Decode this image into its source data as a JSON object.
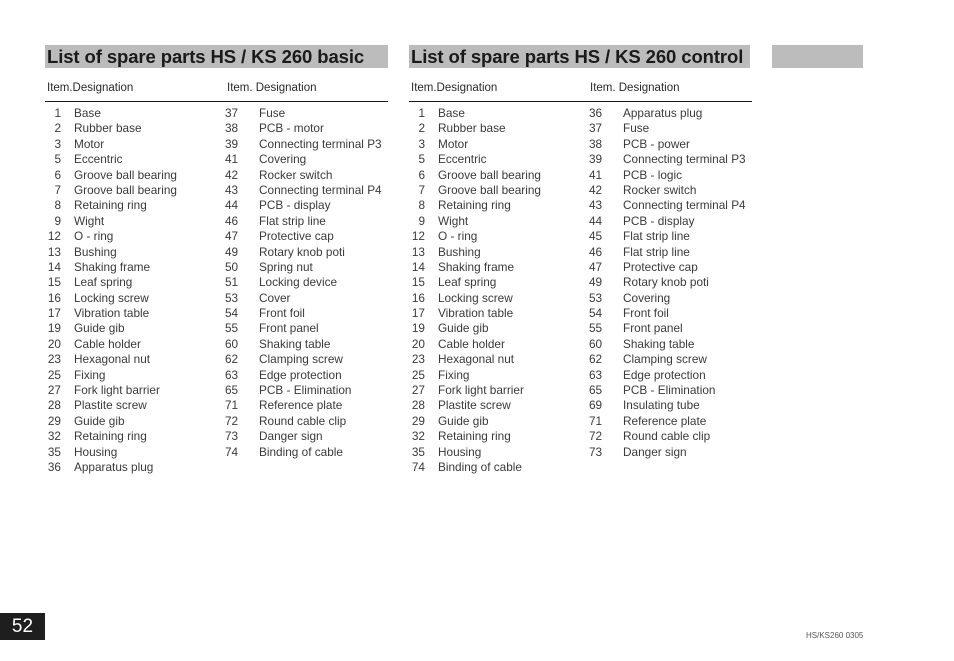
{
  "sections": {
    "basic": {
      "title": "List of spare parts HS / KS 260 basic",
      "header_left": "Item.Designation",
      "header_right": "Item.  Designation",
      "left": [
        {
          "item": "1",
          "name": "Base"
        },
        {
          "item": "2",
          "name": "Rubber base"
        },
        {
          "item": "3",
          "name": "Motor"
        },
        {
          "item": "5",
          "name": "Eccentric"
        },
        {
          "item": "6",
          "name": "Groove ball bearing"
        },
        {
          "item": "7",
          "name": "Groove ball bearing"
        },
        {
          "item": "8",
          "name": "Retaining ring"
        },
        {
          "item": "9",
          "name": "Wight"
        },
        {
          "item": "12",
          "name": "O - ring"
        },
        {
          "item": "13",
          "name": "Bushing"
        },
        {
          "item": "14",
          "name": "Shaking frame"
        },
        {
          "item": "15",
          "name": "Leaf spring"
        },
        {
          "item": "16",
          "name": "Locking screw"
        },
        {
          "item": "17",
          "name": "Vibration table"
        },
        {
          "item": "19",
          "name": "Guide gib"
        },
        {
          "item": "20",
          "name": "Cable holder"
        },
        {
          "item": "23",
          "name": "Hexagonal nut"
        },
        {
          "item": "25",
          "name": "Fixing"
        },
        {
          "item": "27",
          "name": "Fork light barrier"
        },
        {
          "item": "28",
          "name": "Plastite screw"
        },
        {
          "item": "29",
          "name": "Guide gib"
        },
        {
          "item": "32",
          "name": "Retaining ring"
        },
        {
          "item": "35",
          "name": "Housing"
        },
        {
          "item": "36",
          "name": "Apparatus plug"
        }
      ],
      "right": [
        {
          "item": "37",
          "name": "Fuse"
        },
        {
          "item": "38",
          "name": "PCB - motor"
        },
        {
          "item": "39",
          "name": "Connecting terminal P3"
        },
        {
          "item": "41",
          "name": "Covering"
        },
        {
          "item": "42",
          "name": "Rocker switch"
        },
        {
          "item": "43",
          "name": "Connecting terminal P4"
        },
        {
          "item": "44",
          "name": "PCB - display"
        },
        {
          "item": "46",
          "name": "Flat strip line"
        },
        {
          "item": "47",
          "name": "Protective cap"
        },
        {
          "item": "49",
          "name": "Rotary knob poti"
        },
        {
          "item": "50",
          "name": "Spring nut"
        },
        {
          "item": "51",
          "name": "Locking device"
        },
        {
          "item": "53",
          "name": "Cover"
        },
        {
          "item": "54",
          "name": "Front foil"
        },
        {
          "item": "55",
          "name": "Front panel"
        },
        {
          "item": "60",
          "name": "Shaking table"
        },
        {
          "item": "62",
          "name": "Clamping screw"
        },
        {
          "item": "63",
          "name": "Edge protection"
        },
        {
          "item": "65",
          "name": "PCB - Elimination"
        },
        {
          "item": "71",
          "name": "Reference plate"
        },
        {
          "item": "72",
          "name": "Round cable clip"
        },
        {
          "item": "73",
          "name": "Danger sign"
        },
        {
          "item": "74",
          "name": "Binding of cable"
        }
      ]
    },
    "control": {
      "title": "List of spare parts HS / KS 260 control",
      "header_left": "Item.Designation",
      "header_right": "Item.  Designation",
      "left": [
        {
          "item": "1",
          "name": "Base"
        },
        {
          "item": "2",
          "name": "Rubber base"
        },
        {
          "item": "3",
          "name": "Motor"
        },
        {
          "item": "5",
          "name": "Eccentric"
        },
        {
          "item": "6",
          "name": "Groove ball bearing"
        },
        {
          "item": "7",
          "name": "Groove ball bearing"
        },
        {
          "item": "8",
          "name": "Retaining ring"
        },
        {
          "item": "9",
          "name": "Wight"
        },
        {
          "item": "12",
          "name": "O - ring"
        },
        {
          "item": "13",
          "name": "Bushing"
        },
        {
          "item": "14",
          "name": "Shaking frame"
        },
        {
          "item": "15",
          "name": "Leaf spring"
        },
        {
          "item": "16",
          "name": "Locking screw"
        },
        {
          "item": "17",
          "name": "Vibration table"
        },
        {
          "item": "19",
          "name": "Guide gib"
        },
        {
          "item": "20",
          "name": "Cable holder"
        },
        {
          "item": "23",
          "name": "Hexagonal nut"
        },
        {
          "item": "25",
          "name": "Fixing"
        },
        {
          "item": "27",
          "name": "Fork light barrier"
        },
        {
          "item": "28",
          "name": "Plastite screw"
        },
        {
          "item": "29",
          "name": "Guide gib"
        },
        {
          "item": "32",
          "name": "Retaining ring"
        },
        {
          "item": "35",
          "name": "Housing"
        },
        {
          "item": "74",
          "name": "Binding of cable"
        }
      ],
      "right": [
        {
          "item": "36",
          "name": "Apparatus plug"
        },
        {
          "item": "37",
          "name": "Fuse"
        },
        {
          "item": "38",
          "name": "PCB - power"
        },
        {
          "item": "39",
          "name": "Connecting terminal P3"
        },
        {
          "item": "41",
          "name": "PCB - logic"
        },
        {
          "item": "42",
          "name": "Rocker switch"
        },
        {
          "item": "43",
          "name": "Connecting terminal P4"
        },
        {
          "item": "44",
          "name": "PCB - display"
        },
        {
          "item": "45",
          "name": "Flat strip line"
        },
        {
          "item": "46",
          "name": "Flat strip line"
        },
        {
          "item": "47",
          "name": "Protective cap"
        },
        {
          "item": "49",
          "name": "Rotary knob poti"
        },
        {
          "item": "53",
          "name": "Covering"
        },
        {
          "item": "54",
          "name": "Front foil"
        },
        {
          "item": "55",
          "name": "Front panel"
        },
        {
          "item": "60",
          "name": "Shaking table"
        },
        {
          "item": "62",
          "name": "Clamping screw"
        },
        {
          "item": "63",
          "name": "Edge protection"
        },
        {
          "item": "65",
          "name": "PCB - Elimination"
        },
        {
          "item": "69",
          "name": "Insulating tube"
        },
        {
          "item": "71",
          "name": "Reference plate"
        },
        {
          "item": "72",
          "name": "Round cable clip"
        },
        {
          "item": "73",
          "name": "Danger sign"
        }
      ]
    }
  },
  "footer": {
    "page_number": "52",
    "doc_code": "HS/KS260 0305"
  },
  "colors": {
    "title_bar": "#bcbcbc",
    "page_badge": "#1e1e1e"
  }
}
